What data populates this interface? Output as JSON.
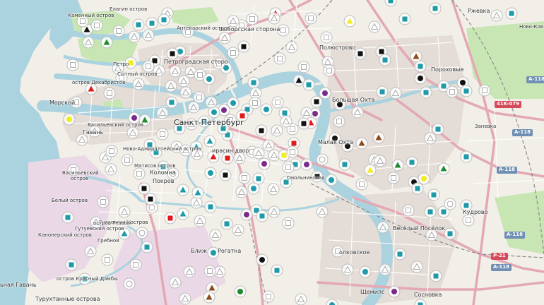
{
  "map": {
    "labels": [
      {
        "id": "petrogradskaya",
        "text": "Петроградская сторо"
      },
      {
        "id": "vyborgskaya",
        "text": "Выборгская сторона"
      },
      {
        "id": "aptekarsky",
        "text": "Аптекарский остров"
      },
      {
        "id": "elagin",
        "text": "Елагин остров"
      },
      {
        "id": "kamenny",
        "text": "Каменный остров"
      },
      {
        "id": "petrovsky",
        "text": "Петро"
      },
      {
        "id": "sytny",
        "text": "Сытный остров"
      },
      {
        "id": "dekabristov",
        "text": "остров Декабристов"
      },
      {
        "id": "morskoy",
        "text": "Морской"
      },
      {
        "id": "gavan",
        "text": "Гавань"
      },
      {
        "id": "vasilievsky",
        "text": "Васильевский остров"
      },
      {
        "id": "vasilievsky2",
        "text": "Васильевский"
      },
      {
        "id": "vasilievsky3",
        "text": "остров"
      },
      {
        "id": "spb",
        "text": "Санкт-Петербург"
      },
      {
        "id": "novo_admiralt",
        "text": "Ново-Адмиралтейский остров"
      },
      {
        "id": "matisov",
        "text": "Матисов остров"
      },
      {
        "id": "kolomna",
        "text": "Коломна"
      },
      {
        "id": "pokrov",
        "text": "Покров"
      },
      {
        "id": "kirasin",
        "text": "ирасин двор"
      },
      {
        "id": "beliy",
        "text": "Белый остров"
      },
      {
        "id": "gutuevsky",
        "text": "Гутуевский остров"
      },
      {
        "id": "gutuevsky2",
        "text": "Гутуевский остров"
      },
      {
        "id": "kanonersky",
        "text": "Канонерский остров"
      },
      {
        "id": "grebnoy",
        "text": "Гребной"
      },
      {
        "id": "rezvy",
        "text": "остров Резвый"
      },
      {
        "id": "blizh",
        "text": "Ближ"
      },
      {
        "id": "rogatka",
        "text": "Рогатка"
      },
      {
        "id": "gavan2",
        "text": "ьная Гавань"
      },
      {
        "id": "turukhtanny",
        "text": "Турухтанные острова"
      },
      {
        "id": "krasny",
        "text": "остров Красный Дамбы"
      },
      {
        "id": "poljustrovo",
        "text": "Полюстрово"
      },
      {
        "id": "porokhovye",
        "text": "Пороховые"
      },
      {
        "id": "rzhevka",
        "text": "Ржевка"
      },
      {
        "id": "novo_kov",
        "text": "Ново-Ков"
      },
      {
        "id": "zanevka",
        "text": "Заневка"
      },
      {
        "id": "bolsh_okhta",
        "text": "Большая Охта"
      },
      {
        "id": "malaya_okhta",
        "text": "Малая Охта"
      },
      {
        "id": "smolnoe",
        "text": "Смольнинская"
      },
      {
        "id": "kudrovo",
        "text": "Кудрово"
      },
      {
        "id": "vesely",
        "text": "Весёлый Посёлок"
      },
      {
        "id": "volkovskoe",
        "text": "олковское"
      },
      {
        "id": "shchemilovka",
        "text": "Щемилс"
      },
      {
        "id": "sosnovka",
        "text": "Сосновка"
      }
    ],
    "shields": [
      {
        "id": "a118a",
        "text": "A-118"
      },
      {
        "id": "a118b",
        "text": "A-118"
      },
      {
        "id": "a118c",
        "text": "A-118"
      },
      {
        "id": "a118d",
        "text": "A-118"
      },
      {
        "id": "a118e",
        "text": "A-118"
      },
      {
        "id": "k079",
        "text": "41K-079"
      },
      {
        "id": "r21",
        "text": "P-21"
      }
    ],
    "colors": {
      "land": "#f2efe9",
      "water": "#aad3df",
      "park": "#c8e6b4",
      "urban": "#e4dcd6",
      "industrial": "#ead8e6",
      "major_road": "#e3a8b4",
      "road": "#ffffff",
      "rail": "#888888"
    }
  },
  "markers": {
    "colors": {
      "black": "#111111",
      "teal": "#1f9aa8",
      "green": "#1f8a2f",
      "purple": "#7b2a8c",
      "red": "#e01a1a",
      "yellow": "#f2ec1e",
      "brown": "#8a4a1c",
      "white": "#ffffff"
    }
  }
}
